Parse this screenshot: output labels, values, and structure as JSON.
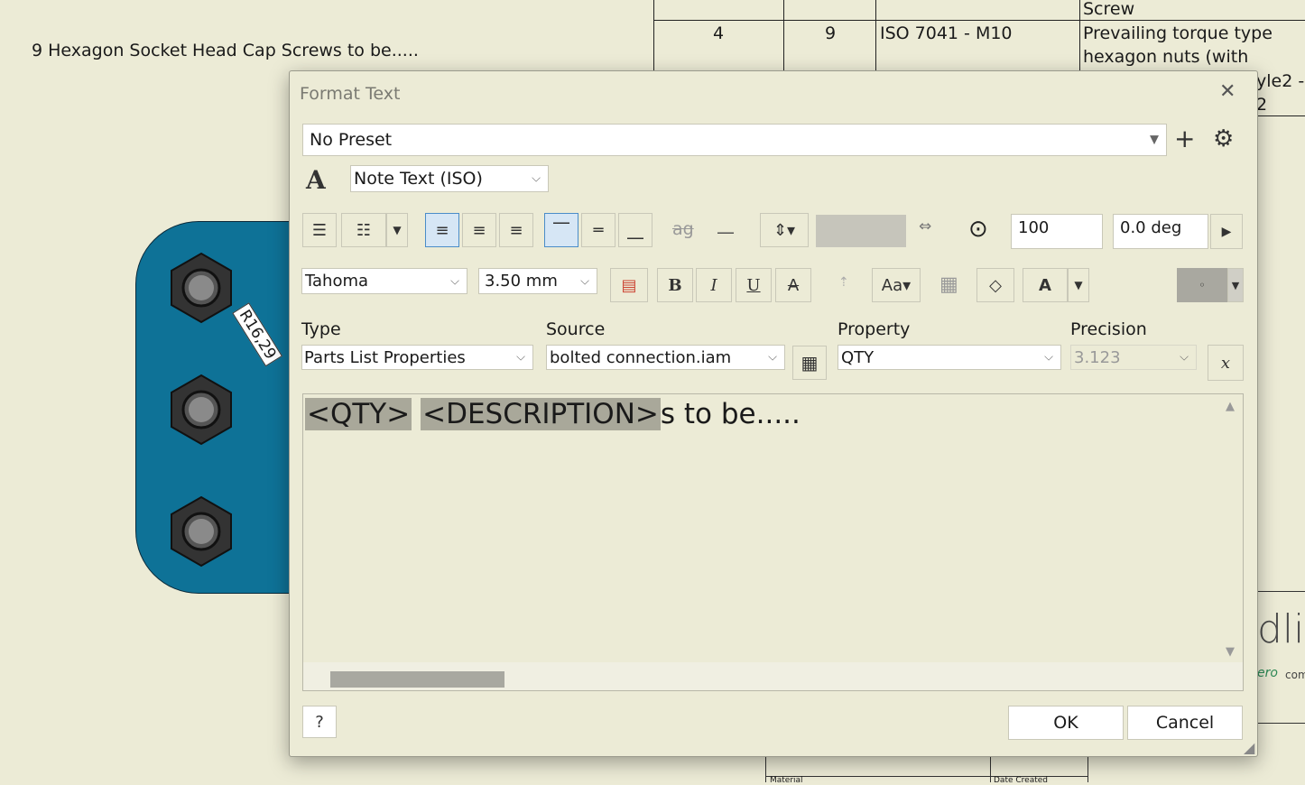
{
  "background": {
    "note_text": "9 Hexagon Socket Head Cap Screws to be.....",
    "table": {
      "row_top_text": "Screw",
      "row_item": "4",
      "row_qty": "9",
      "row_part": "ISO 7041 - M10",
      "row_desc_line1": "Prevailing torque type",
      "row_desc_line2": "hexagon nuts (with",
      "overflow_line1": "yle2 -",
      "overflow_line2": "2"
    },
    "dimension_label": "R16,29",
    "logo_fragment": "dlin",
    "logo_sub_green": "ero",
    "logo_sub_gray": "com",
    "bottom_frame_left": "Material",
    "bottom_frame_right": "Date Created"
  },
  "dialog": {
    "title": "Format Text",
    "preset": {
      "value": "No Preset"
    },
    "style": {
      "value": "Note Text (ISO)"
    },
    "zoom_value": "100",
    "angle_value": "0.0 deg",
    "font": {
      "value": "Tahoma"
    },
    "font_size": {
      "value": "3.50 mm"
    },
    "labels": {
      "type": "Type",
      "source": "Source",
      "property": "Property",
      "precision": "Precision"
    },
    "type_value": "Parts List Properties",
    "source_value": "bolted connection.iam",
    "property_value": "QTY",
    "precision_value": "3.123",
    "editor": {
      "field1": "<QTY>",
      "field2": "<DESCRIPTION>",
      "trailing_text": "s to be....."
    },
    "ok_label": "OK",
    "cancel_label": "Cancel",
    "icons": {
      "bold": "B",
      "italic": "I",
      "underline": "U",
      "strike": "A",
      "text_color": "A",
      "symbol": "x"
    },
    "accent_color": "#4a8cc8",
    "part_color": "#0e7297"
  }
}
